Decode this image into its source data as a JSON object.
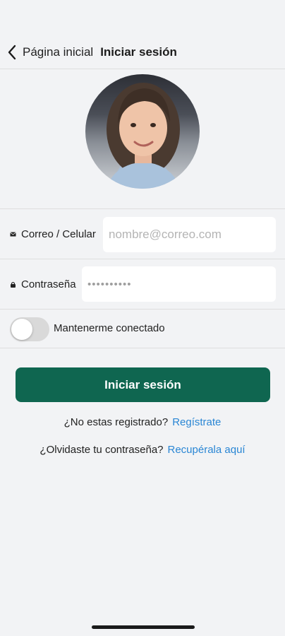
{
  "nav": {
    "back_label": "Página inicial",
    "title": "Iniciar sesión"
  },
  "form": {
    "email_label": "Correo / Celular",
    "email_placeholder": "nombre@correo.com",
    "password_label": "Contraseña",
    "password_placeholder": "••••••••••",
    "keep_connected_label": "Mantenerme conectado",
    "keep_connected_on": false
  },
  "actions": {
    "login_label": "Iniciar sesión",
    "register_question": "¿No estas registrado?",
    "register_link": "Regístrate",
    "forgot_question": "¿Olvidaste tu contraseña?",
    "forgot_link": "Recupérala aquí"
  },
  "icons": {
    "back": "chevron-left-icon",
    "email": "mail-icon",
    "password": "lock-icon"
  },
  "colors": {
    "primary": "#0f6650",
    "link": "#2a86d4",
    "background": "#f2f3f5"
  }
}
